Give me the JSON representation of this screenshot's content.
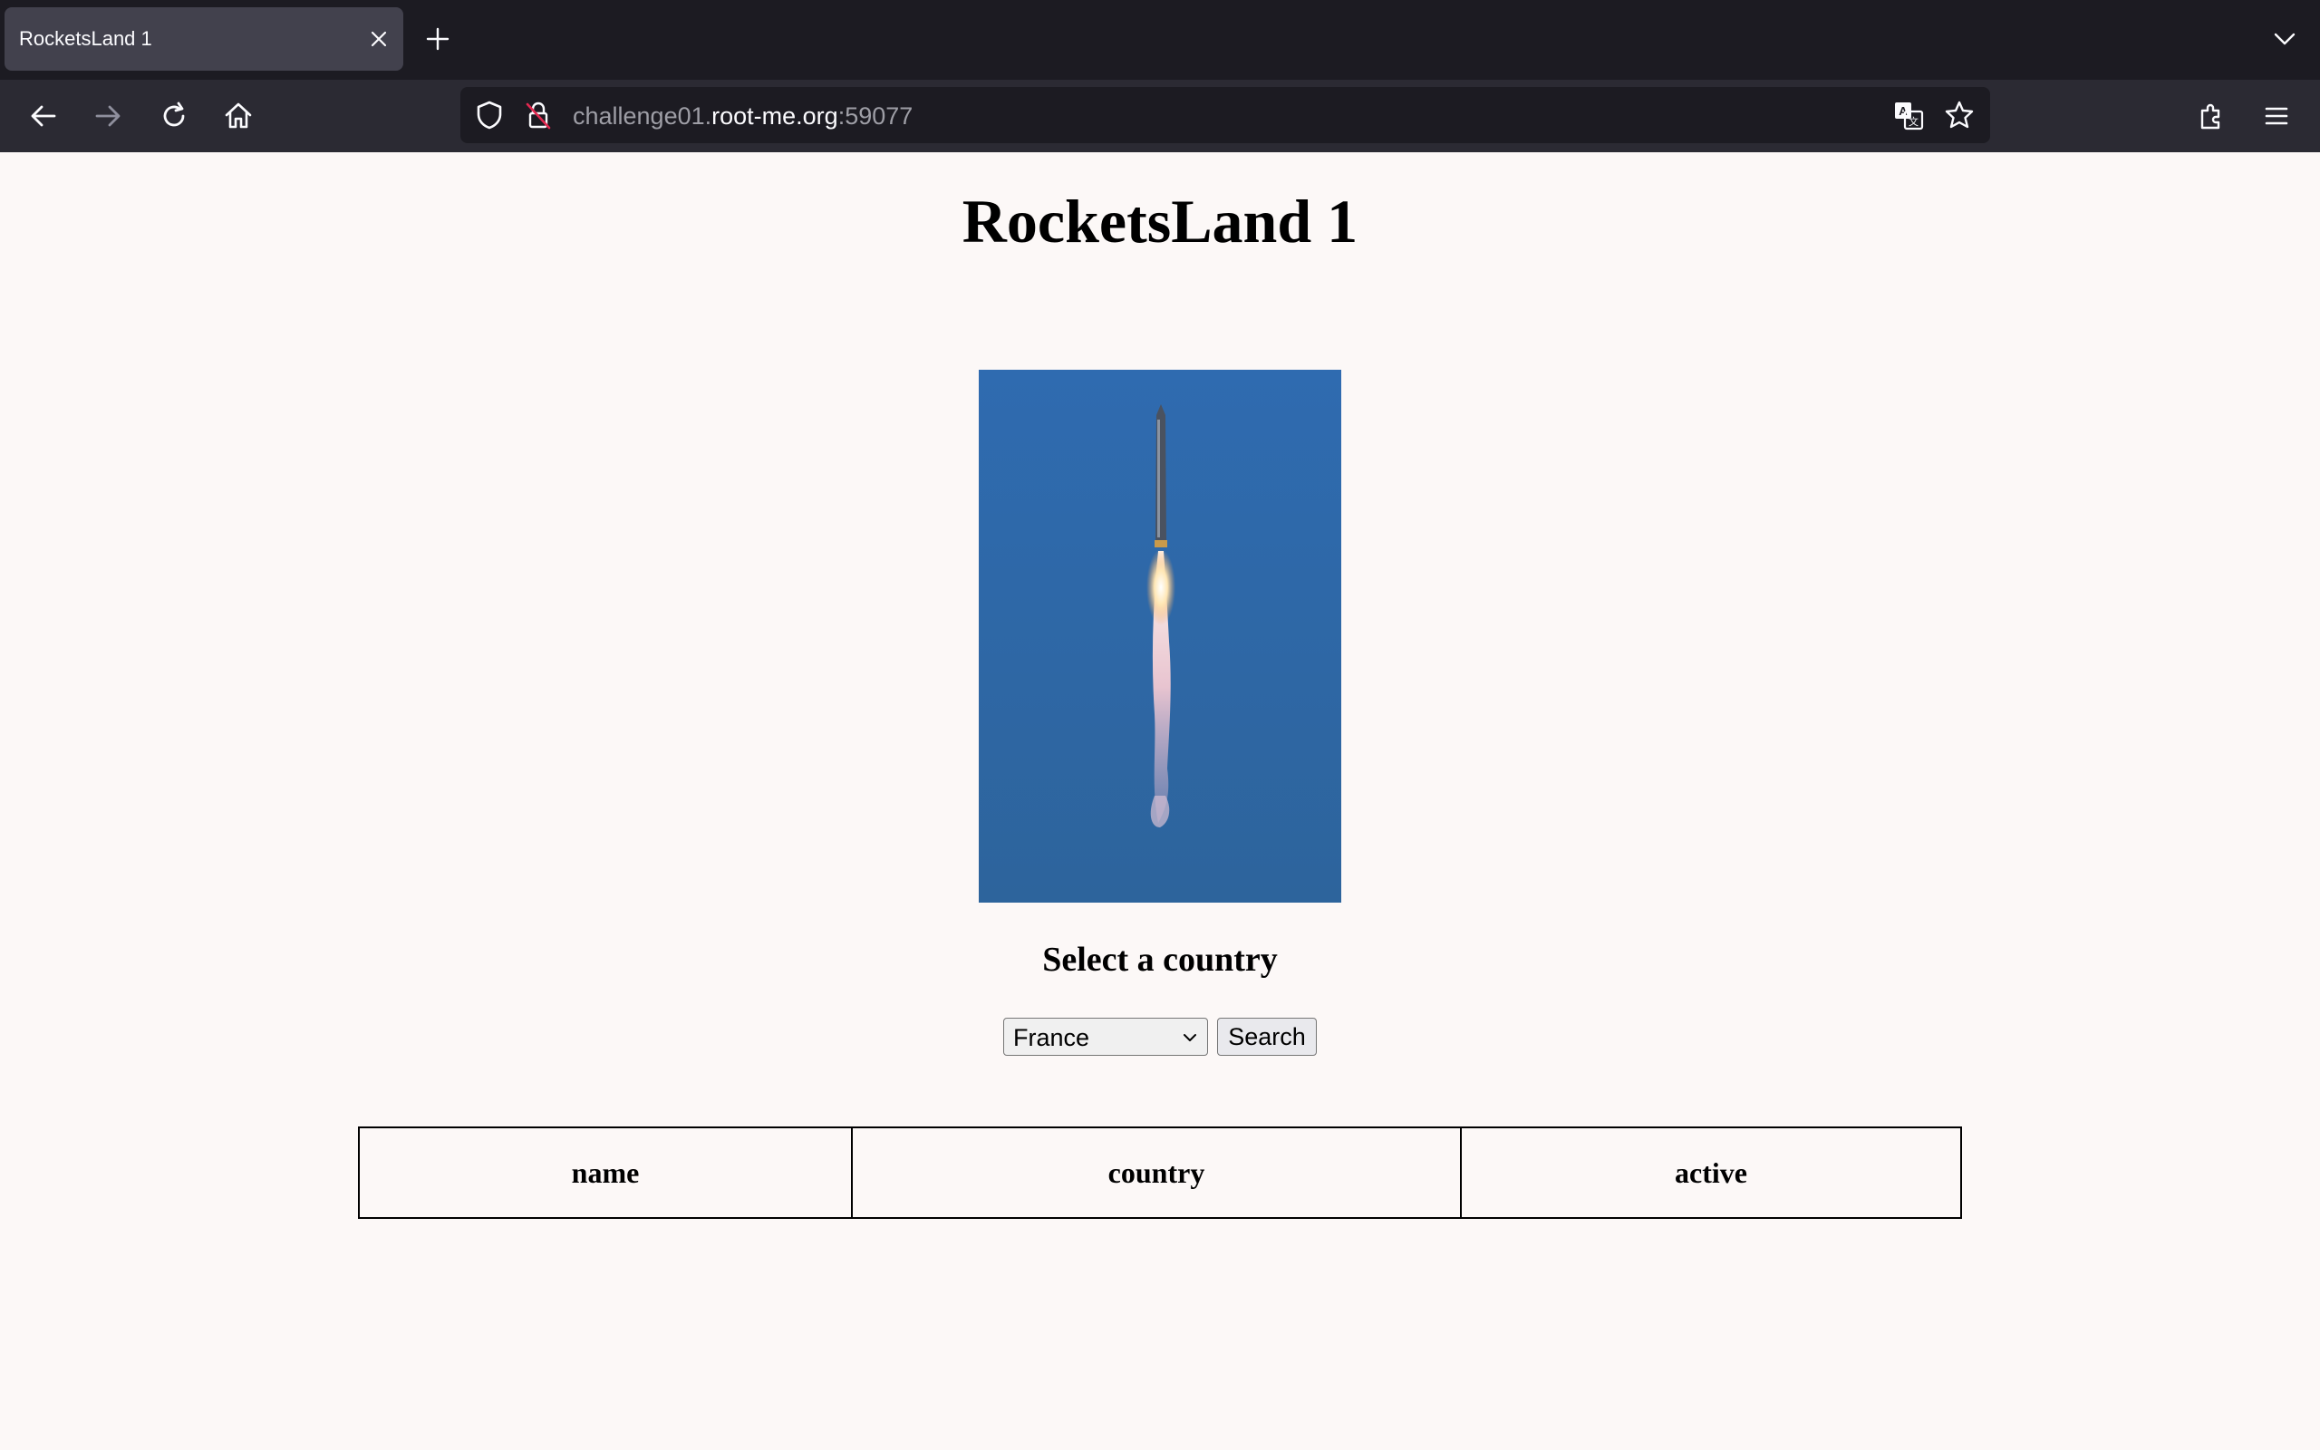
{
  "browser": {
    "tab_title": "RocketsLand 1",
    "url_prefix": "challenge01.",
    "url_domain": "root-me.org",
    "url_port": ":59077",
    "icons": [
      "close-icon",
      "plus-icon",
      "chevron-down-icon",
      "back-arrow-icon",
      "forward-arrow-icon",
      "reload-icon",
      "home-icon",
      "shield-icon",
      "insecure-lock-icon",
      "translate-icon",
      "star-icon",
      "extensions-icon",
      "menu-icon"
    ]
  },
  "page": {
    "title": "RocketsLand 1",
    "form_heading": "Select a country",
    "country_selected": "France",
    "search_label": "Search",
    "table_headers": [
      "name",
      "country",
      "active"
    ]
  },
  "colors": {
    "page_background": "#fcf8f7",
    "chrome_dark": "#1c1b22",
    "toolbar": "#2b2a33",
    "sky_blue": "#2f6aa3"
  }
}
